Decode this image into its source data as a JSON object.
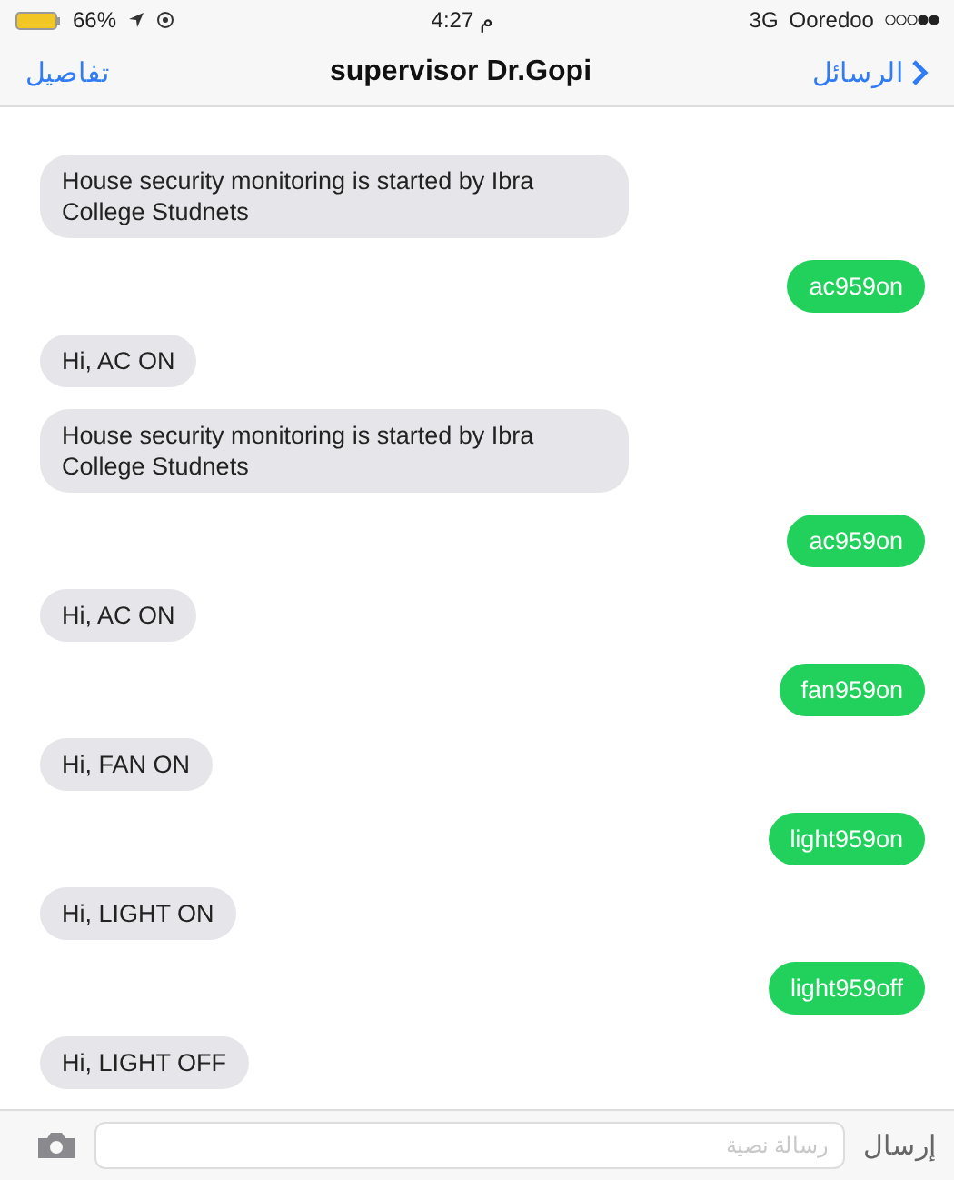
{
  "status_bar": {
    "battery": "66%",
    "time": "م 4:27",
    "network": "3G",
    "carrier": "Ooredoo"
  },
  "nav": {
    "back": "الرسائل",
    "title": "supervisor Dr.Gopi",
    "details": "تفاصيل"
  },
  "messages": [
    {
      "kind": "received",
      "text": "House security monitoring is started by Ibra College Studnets"
    },
    {
      "kind": "sent",
      "text": "ac959on"
    },
    {
      "kind": "received",
      "text": "Hi, AC ON"
    },
    {
      "kind": "received",
      "text": "House security monitoring is started by Ibra College Studnets"
    },
    {
      "kind": "sent",
      "text": "ac959on"
    },
    {
      "kind": "received",
      "text": "Hi, AC ON"
    },
    {
      "kind": "sent",
      "text": "fan959on"
    },
    {
      "kind": "received",
      "text": "Hi, FAN ON"
    },
    {
      "kind": "sent",
      "text": "light959on"
    },
    {
      "kind": "received",
      "text": "Hi, LIGHT ON"
    },
    {
      "kind": "sent",
      "text": "light959off"
    },
    {
      "kind": "received",
      "text": "Hi, LIGHT OFF"
    }
  ],
  "composer": {
    "placeholder": "رسالة نصية",
    "send": "إرسال"
  }
}
